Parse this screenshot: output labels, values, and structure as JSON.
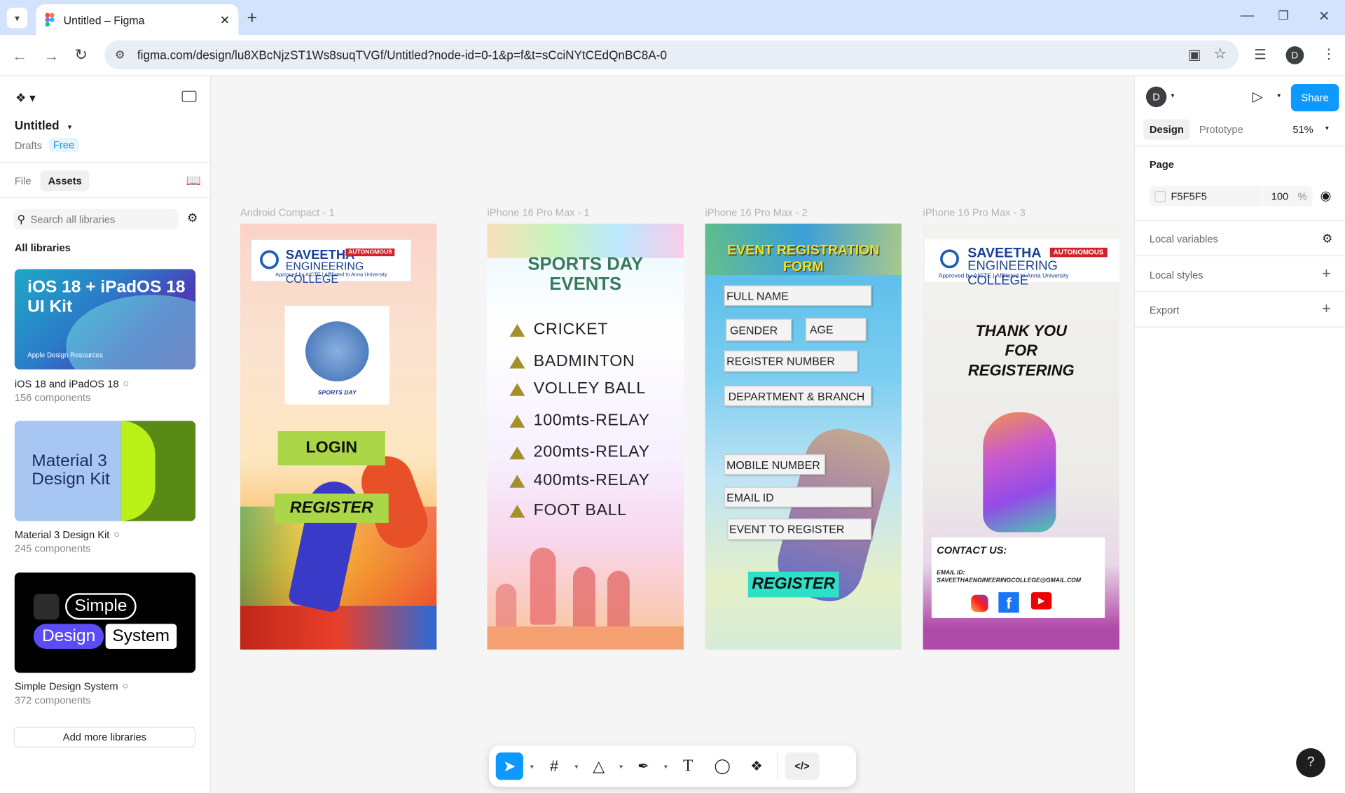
{
  "browser": {
    "tab_title": "Untitled – Figma",
    "url": "figma.com/design/lu8XBcNjzST1Ws8suqTVGf/Untitled?node-id=0-1&p=f&t=sCciNYtCEdQnBC8A-0",
    "profile_initial": "D"
  },
  "left_panel": {
    "file_name": "Untitled",
    "location": "Drafts",
    "plan_badge": "Free",
    "tabs": [
      "File",
      "Assets"
    ],
    "search_placeholder": "Search all libraries",
    "section_title": "All libraries",
    "libraries": [
      {
        "name": "iOS 18 and iPadOS 18",
        "count": "156 components",
        "thumb_title": "iOS 18 + iPadOS 18 UI Kit",
        "thumb_sub": "Apple Design Resources"
      },
      {
        "name": "Material 3 Design Kit",
        "count": "245 components",
        "thumb_title": "Material 3 Design Kit"
      },
      {
        "name": "Simple Design System",
        "count": "372 components",
        "thumb_words": [
          "Simple",
          "Design",
          "System"
        ]
      }
    ],
    "add_button": "Add more libraries"
  },
  "right_panel": {
    "avatar": "D",
    "share": "Share",
    "tabs": [
      "Design",
      "Prototype"
    ],
    "zoom": "51%",
    "page_title": "Page",
    "page_color": "F5F5F5",
    "page_opacity": "100",
    "percent_sign": "%",
    "sections": [
      "Local variables",
      "Local styles",
      "Export"
    ]
  },
  "canvas": {
    "frames": [
      {
        "label": "Android Compact - 1"
      },
      {
        "label": "iPhone 16 Pro Max - 1"
      },
      {
        "label": "iPhone 16 Pro Max - 2"
      },
      {
        "label": "iPhone 16 Pro Max - 3"
      }
    ],
    "college": {
      "name1": "SAVEETHA",
      "name2": "ENGINEERING COLLEGE",
      "badge": "AUTONOMOUS",
      "sub": "Approved by AICTE | Affiliated to Anna University"
    },
    "login": {
      "login_btn": "LOGIN",
      "register_btn": "REGISTER",
      "logo_caption": "SPORTS DAY"
    },
    "events": {
      "title1": "SPORTS DAY",
      "title2": "EVENTS",
      "items": [
        "CRICKET",
        "BADMINTON",
        "VOLLEY BALL",
        "100mts-RELAY",
        "200mts-RELAY",
        "400mts-RELAY",
        "FOOT BALL"
      ]
    },
    "form": {
      "title1": "EVENT REGISTRATION",
      "title2": "FORM",
      "fields": {
        "full_name": "FULL NAME",
        "gender": "GENDER",
        "age": "AGE",
        "register_number": "REGISTER NUMBER",
        "department": "DEPARTMENT & BRANCH",
        "mobile": "MOBILE NUMBER",
        "email": "EMAIL ID",
        "event": "EVENT TO REGISTER"
      },
      "submit": "REGISTER"
    },
    "thanks": {
      "line1": "THANK YOU",
      "line2": "FOR",
      "line3": "REGISTERING",
      "contact": "CONTACT US:",
      "email_label": "EMAIL ID:",
      "email": "SAVEETHAENGINEERINGCOLLEGE@GMAIL.COM"
    }
  },
  "toolbar": {
    "tools": [
      "move-tool",
      "frame-tool",
      "shape-tool",
      "pen-tool",
      "text-tool",
      "comment-tool",
      "actions-tool",
      "dev-mode-toggle"
    ]
  },
  "help": "?"
}
